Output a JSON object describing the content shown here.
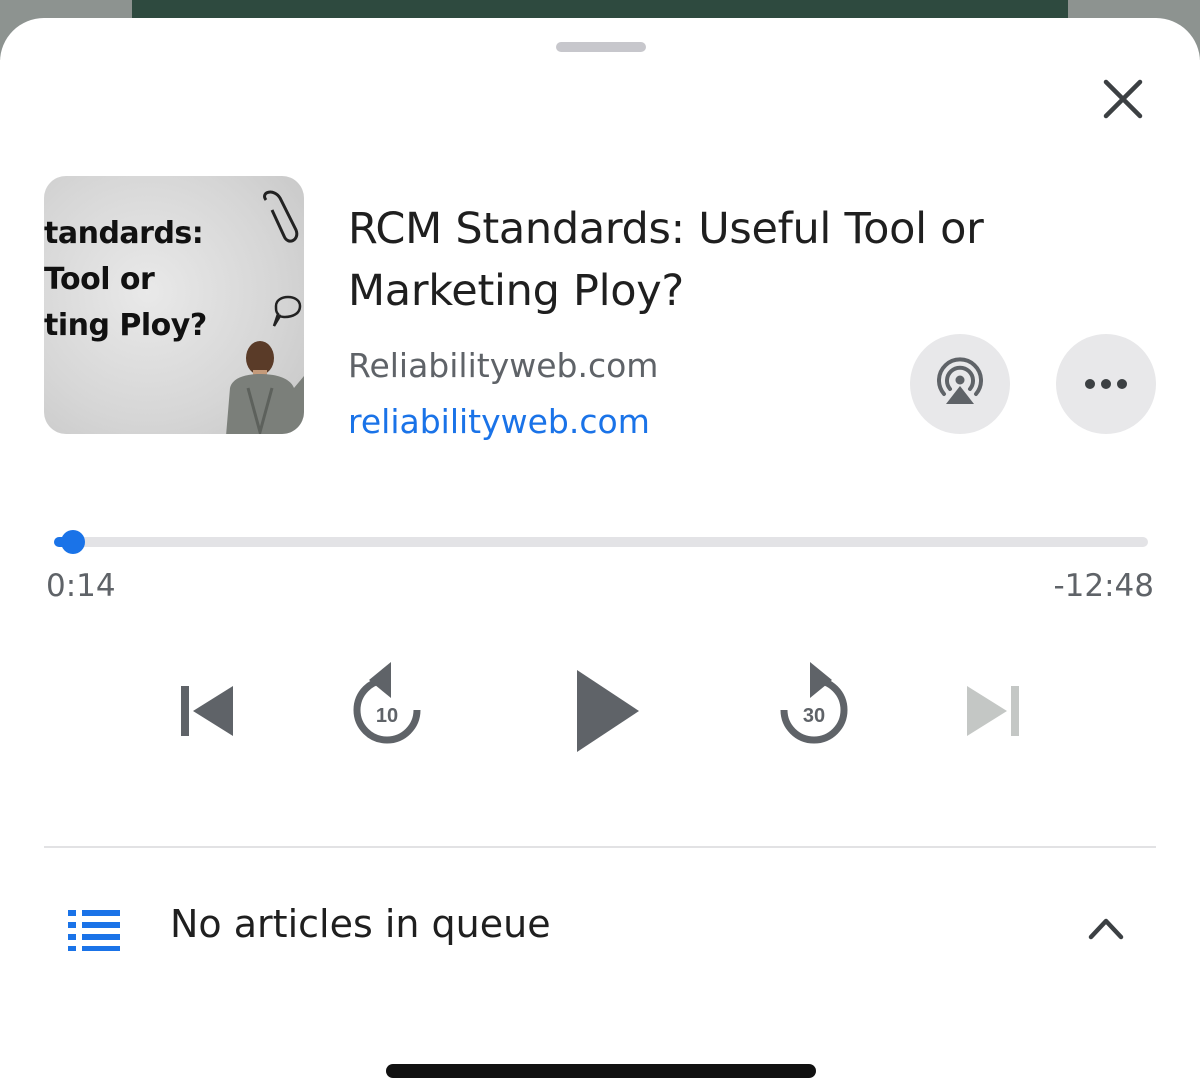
{
  "artwork": {
    "lines": [
      "tandards:",
      " Tool or",
      "ting Ploy?"
    ]
  },
  "article": {
    "title": "RCM Standards: Useful Tool or Marketing Ploy?",
    "publisher": "Reliabilityweb.com",
    "domain": "reliabilityweb.com"
  },
  "player": {
    "elapsed": "0:14",
    "remaining": "-12:48",
    "progress_fraction": 0.0175,
    "rewind_seconds": "10",
    "forward_seconds": "30"
  },
  "queue": {
    "label": "No articles in queue"
  },
  "icons": {
    "close": "close-icon",
    "airplay": "airplay-icon",
    "more": "more-icon",
    "previous": "skip-previous-icon",
    "rewind": "rewind-10-icon",
    "play": "play-icon",
    "forward": "forward-30-icon",
    "next": "skip-next-icon",
    "queue": "list-icon",
    "expand": "chevron-up-icon"
  },
  "colors": {
    "accent": "#1a73e8",
    "icon": "#5f6368",
    "icon_disabled": "#c4c7c5",
    "button_bg": "#e8e8ea"
  }
}
